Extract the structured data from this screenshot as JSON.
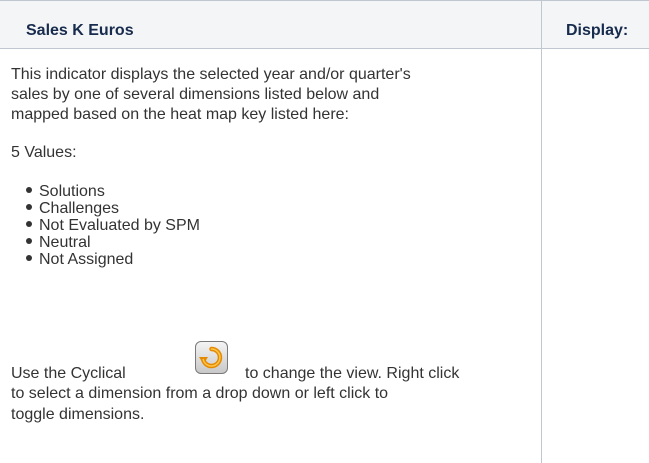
{
  "header": {
    "col1": "Sales K Euros",
    "col2": "Display:"
  },
  "content": {
    "intro_lines": [
      "This indicator displays the selected year and/or quarter's",
      "sales by one of several dimensions listed below and",
      "mapped based on the heat map key listed here:"
    ],
    "values_heading": "5 Values:",
    "values": [
      "Solutions",
      "Challenges",
      "Not Evaluated by SPM",
      "Neutral",
      "Not Assigned"
    ],
    "cyclical_line1_before": "Use the Cyclical",
    "cyclical_line1_after": "to change the view. Right click",
    "cyclical_line2": "to select a dimension from a drop down or left click to",
    "cyclical_line3": "toggle dimensions.",
    "cyclical_icon": "cyclical-refresh-icon"
  },
  "colors": {
    "border": "#c1c7d0",
    "header_bg": "#f4f5f7",
    "header_text": "#172b4d",
    "body_text": "#333333",
    "icon_orange": "#f0a020"
  }
}
